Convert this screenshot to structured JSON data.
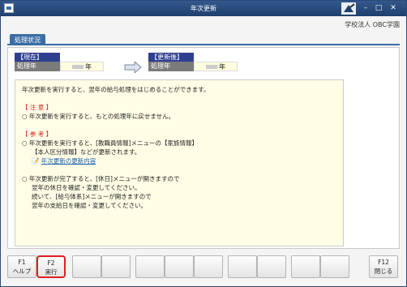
{
  "window": {
    "title": "年次更新"
  },
  "company": "学校法人 OBC学園",
  "tab": {
    "label": "処理状況"
  },
  "current": {
    "header": "【現在】",
    "label": "処理年",
    "unit": "年"
  },
  "after": {
    "header": "【更新後】",
    "label": "処理年",
    "unit": "年"
  },
  "notes": {
    "intro": "年次更新を実行すると、翌年の給与処理をはじめることができます。",
    "caution_title": "【 注 意 】",
    "caution_1": "○ 年次更新を実行すると、もとの処理年に戻せません。",
    "reference_title": "【 参 考 】",
    "ref_1": "○ 年次更新を実行すると、[教職員情報]メニューの【家族情報】",
    "ref_2": "【本人区分情報】などが更新されます。",
    "ref_link": "年次更新の更新内容",
    "done_1": "○ 年次更新が完了すると、[休日]メニューが開きますので",
    "done_2": "翌年の休日を確認・変更してください。",
    "done_3": "続いて、[給与体系]メニューが開きますので",
    "done_4": "翌年の支給日を確認・変更してください。"
  },
  "fkeys": [
    {
      "key": "F1",
      "label": "ヘルプ"
    },
    {
      "key": "F2",
      "label": "実行"
    },
    {
      "key": "",
      "label": ""
    },
    {
      "key": "",
      "label": ""
    },
    {
      "key": "",
      "label": ""
    },
    {
      "key": "",
      "label": ""
    },
    {
      "key": "",
      "label": ""
    },
    {
      "key": "",
      "label": ""
    },
    {
      "key": "",
      "label": ""
    },
    {
      "key": "",
      "label": ""
    },
    {
      "key": "",
      "label": ""
    },
    {
      "key": "F12",
      "label": "閉じる"
    }
  ]
}
